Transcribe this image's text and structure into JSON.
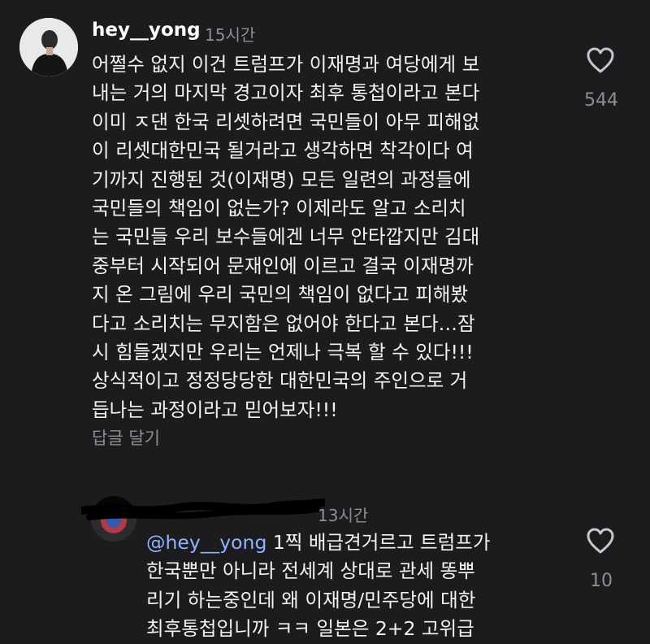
{
  "comment": {
    "username": "hey__yong",
    "time": "15시간",
    "text": "어쩔수 없지 이건 트럼프가 이재명과 여당에게 보\n내는 거의 마지막 경고이자 최후 통첩이라고 본다\n이미 ㅈ댄 한국 리셋하려면 국민들이 아무 피해없\n이 리셋대한민국 될거라고 생각하면 착각이다 여\n기까지 진행된 것(이재명) 모든 일련의 과정들에\n국민들의 책임이 없는가? 이제라도 알고 소리치\n는 국민들 우리 보수들에겐 너무 안타깝지만 김대\n중부터 시작되어 문재인에 이르고 결국 이재명까\n지 온 그림에 우리 국민의 책임이 없다고 피해봤\n다고 소리치는 무지함은 없어야 한다고 본다…잠\n시 힘들겠지만 우리는 언제나 극복 할 수 있다!!!\n상식적이고 정정당당한 대한민국의 주인으로 거\n듭나는 과정이라고 믿어보자!!!",
    "likes": "544",
    "reply_label": "답글 달기"
  },
  "reply": {
    "time": "13시간",
    "mention": "@hey__yong",
    "text": " 1찍 배급견거르고 트럼프가\n한국뿐만 아니라 전세계 상대로 관세 똥뿌\n리기 하는중인데 왜 이재명/민주당에 대한\n최후통첩입니까 ㅋㅋ 일본은 2+2 고위급",
    "likes": "10"
  },
  "icons": {
    "like": "heart-outline-icon"
  },
  "colors": {
    "background": "#1c1c1e",
    "text": "#f2f2f2",
    "muted": "#8e8e93",
    "mention": "#8fb4ff"
  }
}
